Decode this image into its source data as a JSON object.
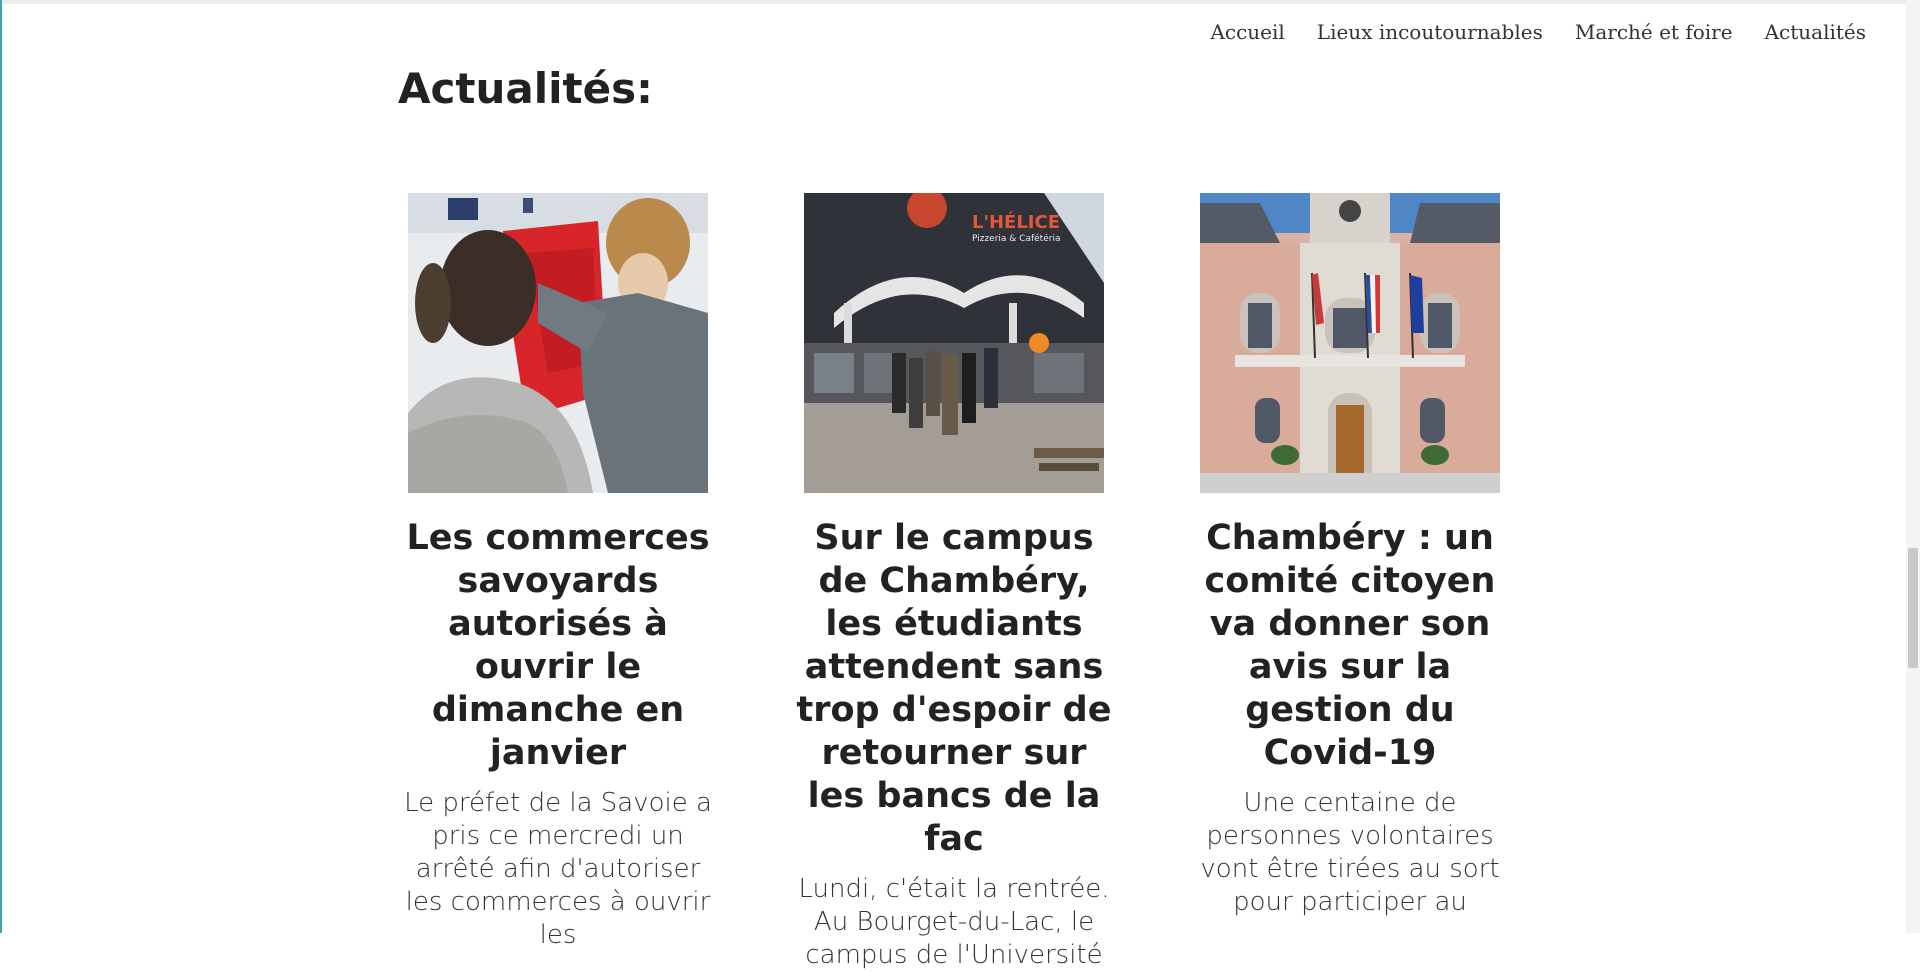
{
  "nav": {
    "items": [
      {
        "label": "Accueil"
      },
      {
        "label": "Lieux incoutournables"
      },
      {
        "label": "Marché et foire"
      },
      {
        "label": "Actualités"
      }
    ]
  },
  "section": {
    "title": "Actualités:"
  },
  "articles": [
    {
      "title": "Les commerces savoyards autorisés à ouvrir le dimanche en janvier",
      "excerpt": "Le préfet de la Savoie a pris ce mercredi un arrêté afin d'autoriser les commerces à ouvrir les",
      "image_icon": "shop-photo-icon"
    },
    {
      "title": "Sur le campus de Chambéry, les étudiants attendent sans trop d'espoir de retourner sur les bancs de la fac",
      "excerpt": "Lundi, c'était la rentrée. Au Bourget-du-Lac, le campus de l'Université",
      "image_icon": "campus-photo-icon",
      "image_sign_title": "L'HÉLICE",
      "image_sign_sub": "Pizzeria & Cafétéria"
    },
    {
      "title": "Chambéry : un comité citoyen va donner son avis sur la gestion du Covid-19",
      "excerpt": "Une centaine de personnes volontaires vont être tirées au sort pour participer au",
      "image_icon": "town-hall-photo-icon"
    }
  ]
}
